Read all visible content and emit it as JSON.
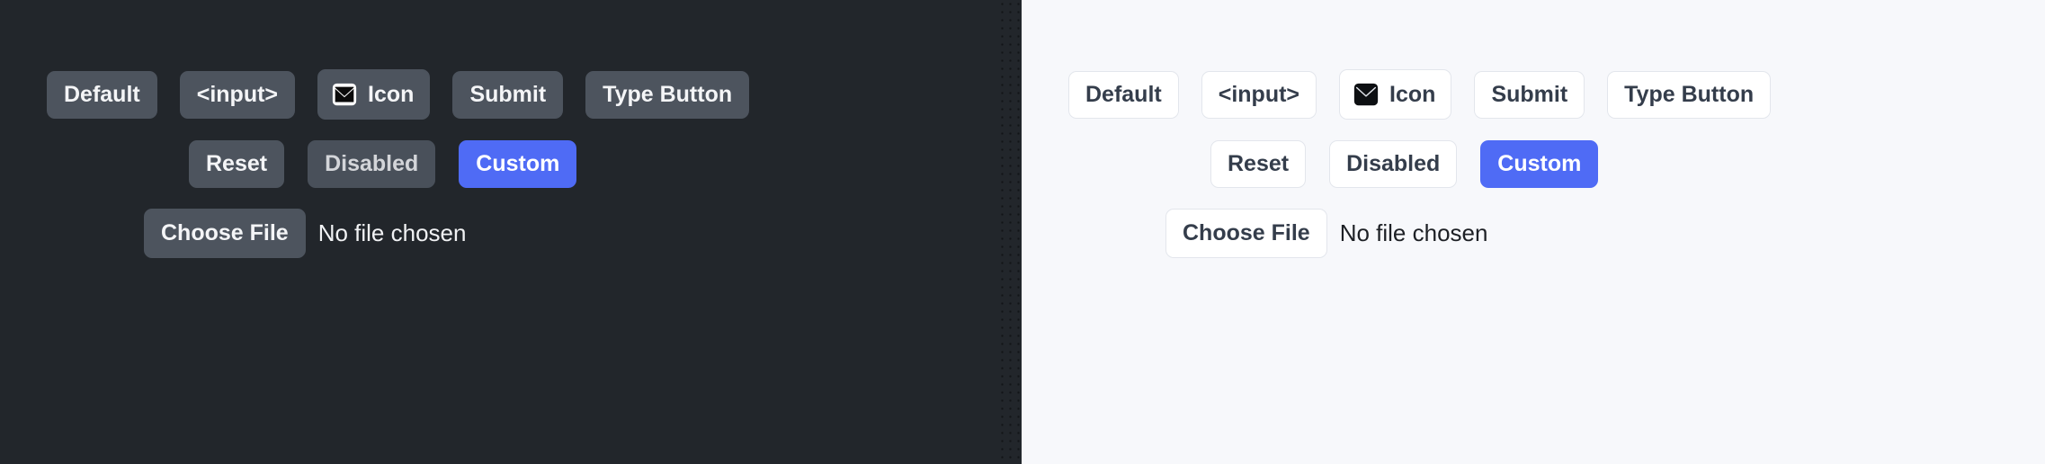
{
  "panels": [
    {
      "theme": "dark",
      "background": "#22262b",
      "button_fill": "#4d545e",
      "text_color": "#f4f5f7",
      "accent": "#4f6bf5"
    },
    {
      "theme": "light",
      "background": "#f7f8fb",
      "button_fill": "#ffffff",
      "border_color": "#e3e6ec",
      "text_color": "#343d4b",
      "accent": "#4f6bf5"
    }
  ],
  "buttons": {
    "row1": [
      {
        "label": "Default",
        "name": "default-button"
      },
      {
        "label": "<input>",
        "name": "input-element-button"
      },
      {
        "label": "Icon",
        "name": "icon-button",
        "icon": "envelope-icon"
      },
      {
        "label": "Submit",
        "name": "submit-button"
      },
      {
        "label": "Type Button",
        "name": "type-button"
      }
    ],
    "row2": [
      {
        "label": "Reset",
        "name": "reset-button"
      },
      {
        "label": "Disabled",
        "name": "disabled-button",
        "state": "disabled"
      },
      {
        "label": "Custom",
        "name": "custom-button",
        "variant": "custom"
      }
    ]
  },
  "file_input": {
    "button_label": "Choose File",
    "status_text": "No file chosen"
  }
}
